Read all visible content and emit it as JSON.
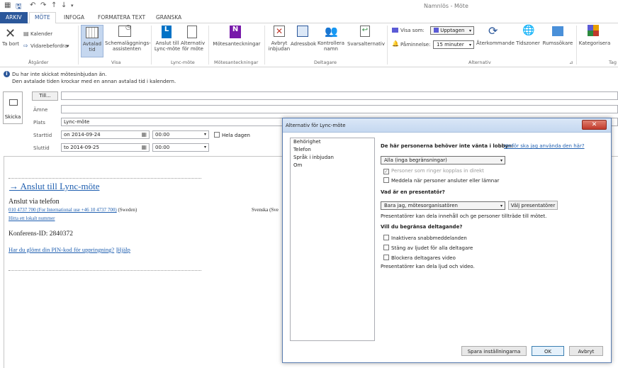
{
  "window": {
    "title": "Namnlös - Möte"
  },
  "tabs": [
    "ARKIV",
    "MÖTE",
    "INFOGA",
    "FORMATERA TEXT",
    "GRANSKA"
  ],
  "ribbon": {
    "atgarder": {
      "ta_bort": "Ta bort",
      "kalender": "Kalender",
      "vidarebefordra": "Vidarebefordra",
      "group": "Åtgärder"
    },
    "visa": {
      "avtalad_tid": "Avtalad tid",
      "schema": "Schemaläggnings-assistenten",
      "group": "Visa"
    },
    "lync": {
      "anslut": "Anslut till Lync-möte",
      "alternativ": "Alternativ för möte",
      "group": "Lync-möte"
    },
    "motesanteckningar": {
      "label": "Mötesanteckningar",
      "group": "Mötesanteckningar"
    },
    "deltagare": {
      "avbryt": "Avbryt inbjudan",
      "adressbok": "Adressbok",
      "kontrollera": "Kontrollera namn",
      "svarsalternativ": "Svarsalternativ",
      "group": "Deltagare"
    },
    "alternativ": {
      "visa_som": "Visa som:",
      "visa_som_value": "Upptagen",
      "paminnelse": "Påminnelse:",
      "paminnelse_value": "15 minuter",
      "aterkommande": "Återkommande",
      "tidszoner": "Tidszoner",
      "rumssokare": "Rumssökare",
      "group": "Alternativ"
    },
    "taggar": {
      "kategorisera": "Kategorisera",
      "group": "Tag"
    }
  },
  "info": {
    "line1": "Du har inte skickat mötesinbjudan än.",
    "line2": "Den avtalade tiden krockar med en annan avtalad tid i kalendern."
  },
  "form": {
    "skicka": "Skicka",
    "till": "Till...",
    "amne": "Ämne",
    "plats": "Plats",
    "plats_value": "Lync-möte",
    "starttid": "Starttid",
    "start_date": "on 2014-09-24",
    "start_time": "00:00",
    "sluttid": "Sluttid",
    "end_date": "to 2014-09-25",
    "end_time": "00:00",
    "hela_dagen": "Hela dagen"
  },
  "body": {
    "join_link": "→ Anslut till Lync-möte",
    "anslut_via": "Anslut via telefon",
    "phone": "010 4737 700 (For International use +46 10 4737 700)",
    "sweden": "(Sweden)",
    "svenska": "Svenska (Sve",
    "hitta": "Hitta ett lokalt nummer",
    "konferens": "Konferens-ID: 2840372",
    "pin": "Har du glömt din PIN-kod för uppringning?",
    "hjalp": "|Hjälp"
  },
  "dialog": {
    "title": "Alternativ för Lync-möte",
    "list": [
      "Behörighet",
      "Telefon",
      "Språk i inbjudan",
      "Om"
    ],
    "lobby_q": "De här personerna behöver inte vänta i lobbyn:",
    "lobby_link": "Varför ska jag använda den här?",
    "lobby_value": "Alla (inga begränsningar)",
    "cb_ringer": "Personer som ringer kopplas in direkt",
    "cb_meddela": "Meddela när personer ansluter eller lämnar",
    "presenter_q": "Vad är en presentatör?",
    "presenter_value": "Bara jag, mötesorganisatören",
    "valj_btn": "Välj presentatörer",
    "presenter_note": "Presentatörer kan dela innehåll och ge personer tillträde till mötet.",
    "limit_q": "Vill du begränsa deltagande?",
    "cb_inaktivera": "Inaktivera snabbmeddelanden",
    "cb_stang": "Stäng av ljudet för alla deltagare",
    "cb_blockera": "Blockera deltagares video",
    "limit_note": "Presentatörer kan dela ljud och video.",
    "spara": "Spara inställningarna",
    "ok": "OK",
    "avbryt": "Avbryt"
  },
  "colors": {
    "accent": "#2b579a",
    "busy": "#5b5bd6",
    "link": "#1f5fb0"
  }
}
